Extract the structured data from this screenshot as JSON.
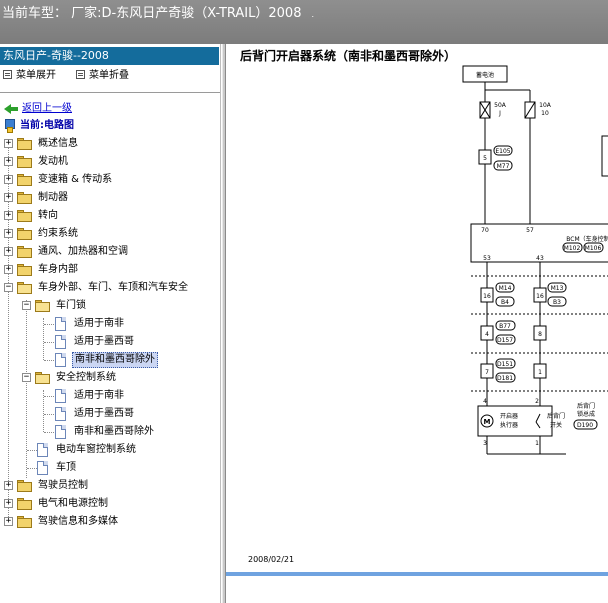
{
  "header": {
    "title": "当前车型：  厂家:D-东风日产奇骏（X-TRAIL）2008"
  },
  "sidebar": {
    "model_title": "东风日产-奇骏--2008",
    "menu_expand": "菜单展开",
    "menu_collapse": "菜单折叠",
    "back_link": "返回上一级",
    "current_label": "当前:电路图",
    "items": [
      {
        "label": "概述信息"
      },
      {
        "label": "发动机"
      },
      {
        "label": "变速箱 & 传动系"
      },
      {
        "label": "制动器"
      },
      {
        "label": "转向"
      },
      {
        "label": "约束系统"
      },
      {
        "label": "通风、加热器和空调"
      },
      {
        "label": "车身内部"
      },
      {
        "label": "车身外部、车门、车顶和汽车安全"
      },
      {
        "label": "车门锁"
      },
      {
        "label": "适用于南非"
      },
      {
        "label": "适用于墨西哥"
      },
      {
        "label": "南非和墨西哥除外"
      },
      {
        "label": "安全控制系统"
      },
      {
        "label": "适用于南非"
      },
      {
        "label": "适用于墨西哥"
      },
      {
        "label": "南非和墨西哥除外"
      },
      {
        "label": "电动车窗控制系统"
      },
      {
        "label": "车顶"
      },
      {
        "label": "驾驶员控制"
      },
      {
        "label": "电气和电源控制"
      },
      {
        "label": "驾驶信息和多媒体"
      }
    ]
  },
  "diagram": {
    "title": "后背门开启器系统（南非和墨西哥除外）",
    "date": "2008/02/21",
    "battery": "蓄电池",
    "fuse1_a": "50A",
    "fuse1_b": "J",
    "fuse2_a": "10A",
    "fuse2_b": "10",
    "conn_e105": "E105",
    "conn_m77": "M77",
    "pin_5": "5",
    "pin_70": "70",
    "pin_57": "57",
    "bcm_label": "BCM（车身控制",
    "bcm_c1": "M102",
    "bcm_c2": "M106",
    "pin_53": "53",
    "pin_43": "43",
    "conn_m14": "M14",
    "conn_b4": "B4",
    "conn_m13": "M13",
    "conn_b3": "B3",
    "pin_16a": "16",
    "pin_16b": "16",
    "conn_b77": "B77",
    "conn_d157": "D157",
    "pin_4a": "4",
    "pin_8": "8",
    "conn_d151": "D151",
    "conn_d181": "D181",
    "pin_7": "7",
    "pin_1": "1",
    "pin_4b": "4",
    "pin_3": "3",
    "pin_2": "2",
    "pin_1b": "1",
    "motor_label1": "开启器",
    "motor_label2": "执行器",
    "switch_label1": "后背门",
    "switch_label2": "开关",
    "side_label1": "后背门",
    "side_label2": "锁总成",
    "conn_d190": "D190"
  }
}
